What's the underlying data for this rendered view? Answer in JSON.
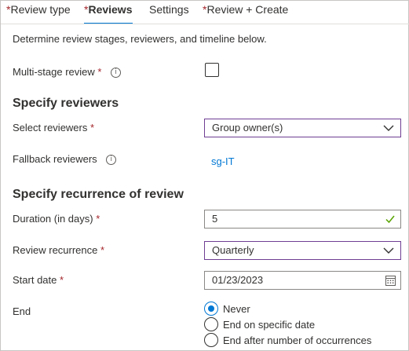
{
  "tabs": [
    {
      "label": "Review type",
      "required": "*",
      "active": false
    },
    {
      "label": "Reviews",
      "required": "*",
      "active": true
    },
    {
      "label": "Settings",
      "required": "",
      "active": false
    },
    {
      "label": "Review + Create",
      "required": "*",
      "active": false
    }
  ],
  "description": "Determine review stages, reviewers, and timeline below.",
  "multi_stage": {
    "label": "Multi-stage review",
    "required": "*",
    "checked": false,
    "info_icon": "info-icon"
  },
  "reviewers_section": {
    "title": "Specify reviewers",
    "select_label": "Select reviewers",
    "select_required": "*",
    "select_value": "Group owner(s)",
    "fallback_label": "Fallback reviewers",
    "fallback_value": "sg-IT"
  },
  "recurrence_section": {
    "title": "Specify recurrence of review",
    "duration_label": "Duration (in days)",
    "duration_required": "*",
    "duration_value": "5",
    "recurrence_label": "Review recurrence",
    "recurrence_required": "*",
    "recurrence_value": "Quarterly",
    "start_label": "Start date",
    "start_required": "*",
    "start_value": "01/23/2023",
    "end_label": "End",
    "end_options": [
      "Never",
      "End on specific date",
      "End after number of occurrences"
    ],
    "end_selected": "Never"
  },
  "colors": {
    "accent": "#0078d4",
    "required": "#a4262c",
    "focus_border": "#6f3d93",
    "valid_check": "#57a300"
  }
}
